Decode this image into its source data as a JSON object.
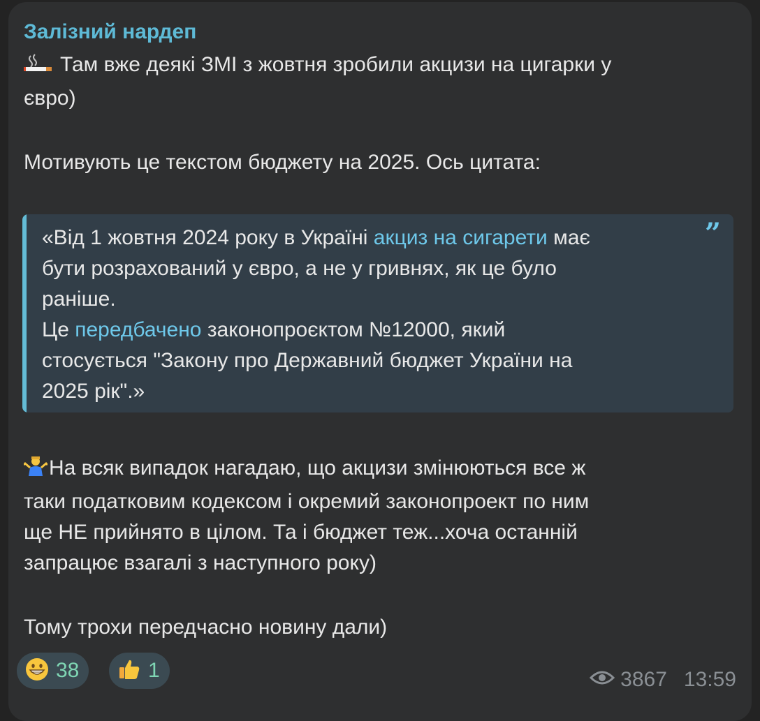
{
  "post": {
    "author": "Залізний нардеп",
    "line1": "Там вже деякі ЗМІ з жовтня зробили акцизи на цигарки у",
    "line2": "євро)",
    "line3": "Мотивують це текстом бюджету на 2025. Ось цитата:",
    "quote": {
      "l1_a": "«Від 1 жовтня 2024 року в Україні ",
      "l1_link": "акциз на сигарети",
      "l1_b": " має",
      "l2": "бути розрахований у євро, а не у гривнях, як це було",
      "l3": "раніше.",
      "l4_a": "Це ",
      "l4_link": "передбачено",
      "l4_b": " законопроєктом №12000, який",
      "l5": "стосується \"Закону про Державний бюджет України на",
      "l6": "2025 рік\".»"
    },
    "para3_l1": "На всяк випадок нагадаю, що акцизи змінюються все ж",
    "para3_l2": "таки податковим кодексом і окремий законопроект по ним",
    "para3_l3": "ще НЕ прийнято в цілом. Та і бюджет теж...хоча останній",
    "para3_l4": "запрацює взагалі з наступного року)",
    "para4": "Тому трохи передчасно новину дали)"
  },
  "icons": {
    "smoking": "smoking-icon",
    "shrug": "person-shrugging-icon",
    "quote": "quote-icon",
    "views": "eye-icon"
  },
  "reactions": [
    {
      "emoji": "grinning-face",
      "count": "38"
    },
    {
      "emoji": "thumbs-up",
      "count": "1"
    }
  ],
  "meta": {
    "views": "3867",
    "time": "13:59"
  },
  "colors": {
    "background": "#232323",
    "bubble": "#2e2f30",
    "accent": "#5ebad6",
    "link": "#6ec8ea",
    "text": "#e8e8e8",
    "meta": "#8a8f94"
  }
}
